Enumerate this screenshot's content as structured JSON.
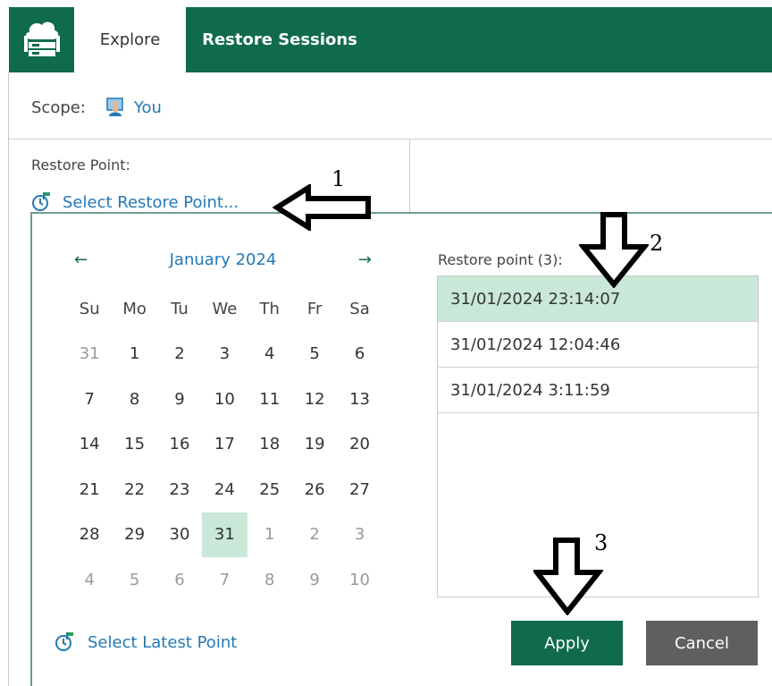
{
  "app": {
    "icon": "backup-server-icon",
    "tabs": [
      {
        "label": "Explore",
        "active": true
      },
      {
        "label": "Restore Sessions",
        "active": false
      }
    ],
    "brand_color": "#0f6b4a"
  },
  "scope": {
    "label": "Scope:",
    "value": "You",
    "icon": "user-icon"
  },
  "restore_point": {
    "label": "Restore Point:",
    "select_link": "Select Restore Point...",
    "icon": "clock-flag-icon"
  },
  "calendar": {
    "month": "January 2024",
    "prev_icon": "arrow-left-icon",
    "next_icon": "arrow-right-icon",
    "weekdays": [
      "Su",
      "Mo",
      "Tu",
      "We",
      "Th",
      "Fr",
      "Sa"
    ],
    "weeks": [
      [
        "31",
        "1",
        "2",
        "3",
        "4",
        "5",
        "6"
      ],
      [
        "7",
        "8",
        "9",
        "10",
        "11",
        "12",
        "13"
      ],
      [
        "14",
        "15",
        "16",
        "17",
        "18",
        "19",
        "20"
      ],
      [
        "21",
        "22",
        "23",
        "24",
        "25",
        "26",
        "27"
      ],
      [
        "28",
        "29",
        "30",
        "31",
        "1",
        "2",
        "3"
      ],
      [
        "4",
        "5",
        "6",
        "7",
        "8",
        "9",
        "10"
      ]
    ],
    "selected_day": "31",
    "select_latest": "Select Latest Point"
  },
  "restore_points": {
    "label": "Restore point (3):",
    "items": [
      "31/01/2024 23:14:07",
      "31/01/2024 12:04:46",
      "31/01/2024 3:11:59"
    ],
    "selected": "31/01/2024 23:14:07"
  },
  "buttons": {
    "apply": "Apply",
    "cancel": "Cancel"
  },
  "annotations": [
    "1",
    "2",
    "3"
  ]
}
